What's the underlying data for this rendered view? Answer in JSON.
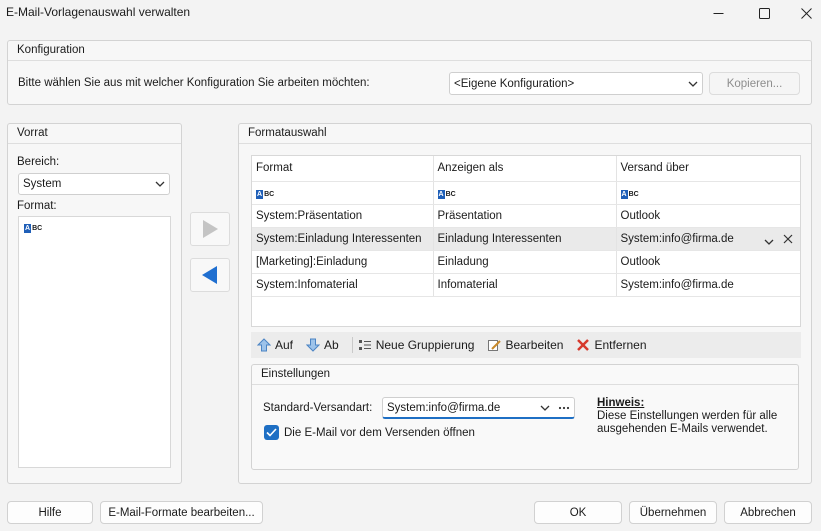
{
  "window": {
    "title": "E-Mail-Vorlagenauswahl verwalten"
  },
  "konfiguration": {
    "header": "Konfiguration",
    "prompt": "Bitte wählen Sie aus mit welcher Konfiguration Sie arbeiten möchten:",
    "selected": "<Eigene Konfiguration>",
    "copy_label": "Kopieren..."
  },
  "vorrat": {
    "header": "Vorrat",
    "bereich_label": "Bereich:",
    "bereich_value": "System",
    "format_label": "Format:",
    "items": [
      {
        "icon": "abc-format-icon"
      }
    ]
  },
  "formatauswahl": {
    "header": "Formatauswahl",
    "columns": [
      "Format",
      "Anzeigen als",
      "Versand über"
    ],
    "rows": [
      {
        "format": "System:Präsentation",
        "anzeigen": "Präsentation",
        "versand": "Outlook"
      },
      {
        "format": "System:Einladung Interessenten",
        "anzeigen": "Einladung Interessenten",
        "versand": "System:info@firma.de"
      },
      {
        "format": "[Marketing]:Einladung",
        "anzeigen": "Einladung",
        "versand": "Outlook"
      },
      {
        "format": "System:Infomaterial",
        "anzeigen": "Infomaterial",
        "versand": "System:info@firma.de"
      }
    ],
    "toolbar": {
      "up": "Auf",
      "down": "Ab",
      "new_group": "Neue Gruppierung",
      "edit": "Bearbeiten",
      "remove": "Entfernen"
    }
  },
  "einstellungen": {
    "header": "Einstellungen",
    "versandart_label": "Standard-Versandart:",
    "versandart_value": "System:info@firma.de",
    "checkbox_label": "Die E-Mail vor dem Versenden öffnen",
    "checkbox_checked": true,
    "hint_title": "Hinweis:",
    "hint_text": "Diese Einstellungen werden für alle ausgehenden E-Mails verwendet."
  },
  "footer": {
    "help": "Hilfe",
    "edit_formats": "E-Mail-Formate bearbeiten...",
    "ok": "OK",
    "apply": "Übernehmen",
    "cancel": "Abbrechen"
  },
  "colors": {
    "accent": "#1e6fc4",
    "arrow": "#1f6fd0",
    "remove": "#d6382c"
  }
}
